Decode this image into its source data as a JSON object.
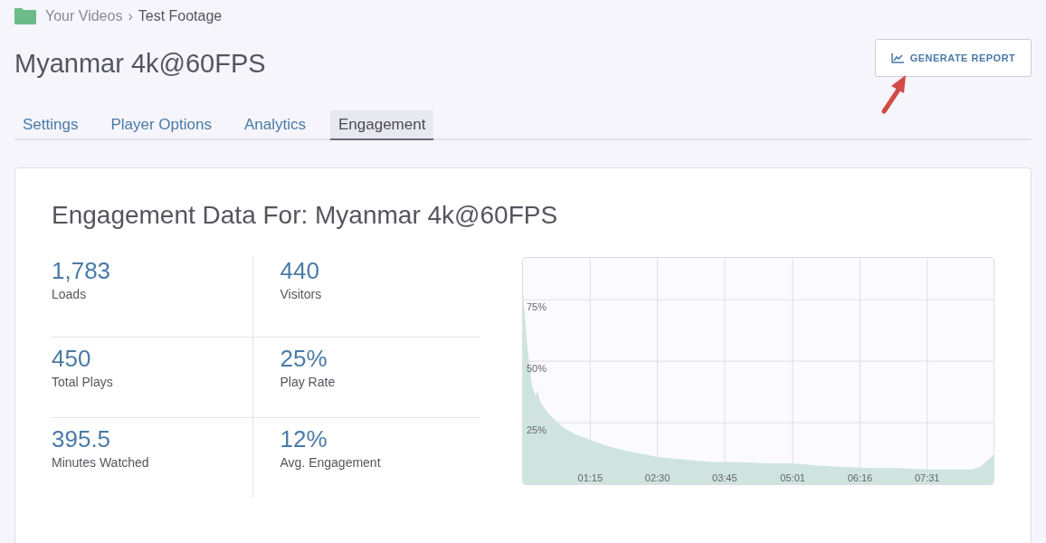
{
  "breadcrumb": {
    "parent": "Your Videos",
    "separator": "›",
    "current": "Test Footage"
  },
  "title": "Myanmar 4k@60FPS",
  "report_button": {
    "label": "GENERATE REPORT"
  },
  "tabs": [
    {
      "label": "Settings",
      "selected": false
    },
    {
      "label": "Player Options",
      "selected": false
    },
    {
      "label": "Analytics",
      "selected": false
    },
    {
      "label": "Engagement",
      "selected": true
    }
  ],
  "panel": {
    "heading": "Engagement Data For: Myanmar 4k@60FPS",
    "stats": [
      {
        "value": "1,783",
        "label": "Loads"
      },
      {
        "value": "440",
        "label": "Visitors"
      },
      {
        "value": "450",
        "label": "Total Plays"
      },
      {
        "value": "25%",
        "label": "Play Rate"
      },
      {
        "value": "395.5",
        "label": "Minutes Watched"
      },
      {
        "value": "12%",
        "label": "Avg. Engagement"
      }
    ],
    "chart_data": {
      "type": "area",
      "xlim": [
        0,
        525
      ],
      "ylim": [
        0,
        92
      ],
      "x": [
        0,
        5,
        10,
        14,
        16,
        20,
        30,
        45,
        60,
        75,
        90,
        110,
        130,
        150,
        180,
        210,
        240,
        270,
        300,
        330,
        360,
        390,
        420,
        450,
        480,
        500,
        510,
        525
      ],
      "grid": true,
      "series": [
        {
          "color": "#cfe4de",
          "values": [
            78,
            55,
            40,
            36,
            38,
            33,
            28,
            23,
            20,
            18,
            16,
            14,
            12.5,
            11,
            10,
            9,
            9,
            8.5,
            8.5,
            7.5,
            7,
            6.5,
            6.5,
            6,
            6,
            6,
            7,
            12
          ]
        }
      ],
      "xticks": [
        {
          "value": 75,
          "label": "01:15"
        },
        {
          "value": 150,
          "label": "02:30"
        },
        {
          "value": 225,
          "label": "03:45"
        },
        {
          "value": 301,
          "label": "05:01"
        },
        {
          "value": 376,
          "label": "06:16"
        },
        {
          "value": 451,
          "label": "07:31"
        }
      ],
      "yticks": [
        {
          "value": 25,
          "label": "25%"
        },
        {
          "value": 50,
          "label": "50%"
        },
        {
          "value": 75,
          "label": "75%"
        }
      ]
    }
  }
}
